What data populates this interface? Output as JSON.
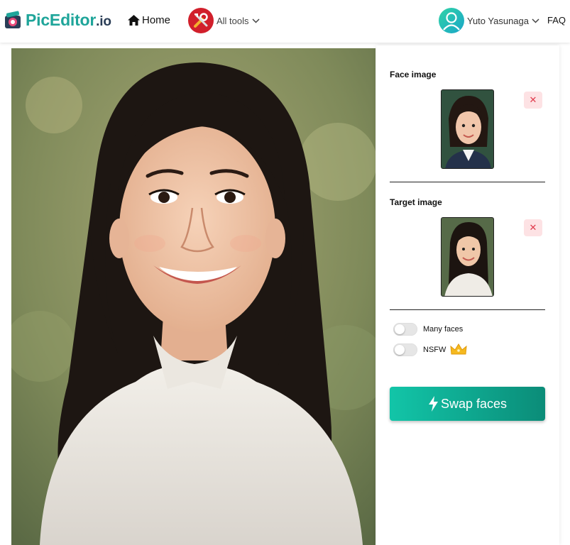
{
  "nav": {
    "logo_main": "PicEditor",
    "logo_suffix": ".io",
    "home_label": "Home",
    "tools_label": "All tools",
    "user_name": "Yuto Yasunaga",
    "faq_label": "FAQ"
  },
  "panel": {
    "face_title": "Face image",
    "target_title": "Target image",
    "remove_symbol": "✕",
    "many_faces_label": "Many faces",
    "nsfw_label": "NSFW",
    "swap_label": "Swap faces"
  },
  "colors": {
    "brand_teal": "#1fa59a",
    "tools_red": "#d11f2b",
    "swap_gradient_start": "#12c5a8",
    "swap_gradient_end": "#0b8c78",
    "remove_bg": "#fde2e4"
  },
  "icons": {
    "home": "home-icon",
    "tools": "tools-icon",
    "chevron": "chevron-down-icon",
    "user": "user-icon",
    "remove": "close-icon",
    "premium": "crown-icon",
    "swap": "lightning-icon"
  }
}
